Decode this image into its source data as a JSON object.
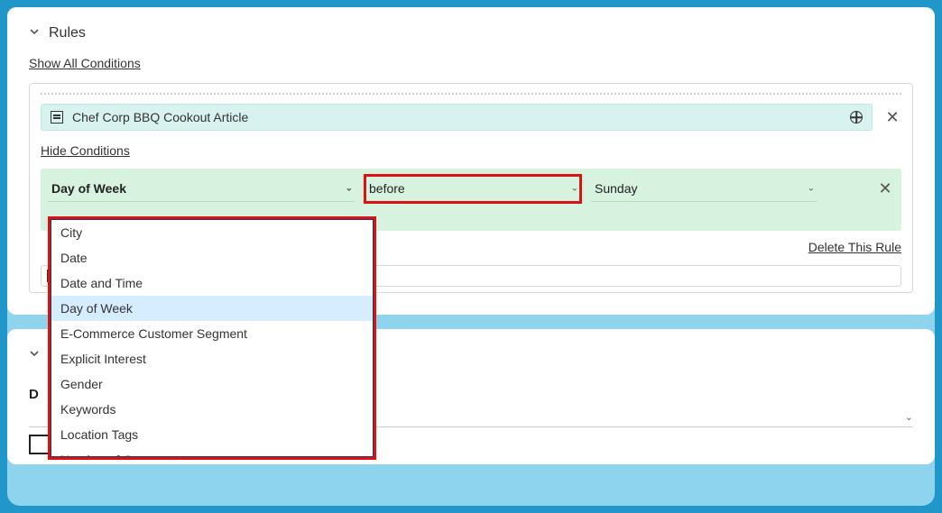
{
  "rules": {
    "heading": "Rules",
    "show_all_link": "Show All Conditions",
    "hide_link": "Hide Conditions",
    "rule_title": "Chef Corp BBQ Cookout Article",
    "delete_link": "Delete This Rule",
    "dd_field": "Day of Week",
    "dd_op": "before",
    "dd_val": "Sunday",
    "field_options": [
      "City",
      "Date",
      "Date and Time",
      "Day of Week",
      "E-Commerce Customer Segment",
      "Explicit Interest",
      "Gender",
      "Keywords",
      "Location Tags",
      "Number of Comments"
    ],
    "highlighted_option": "Day of Week"
  },
  "lower": {
    "label_initial": "D"
  }
}
